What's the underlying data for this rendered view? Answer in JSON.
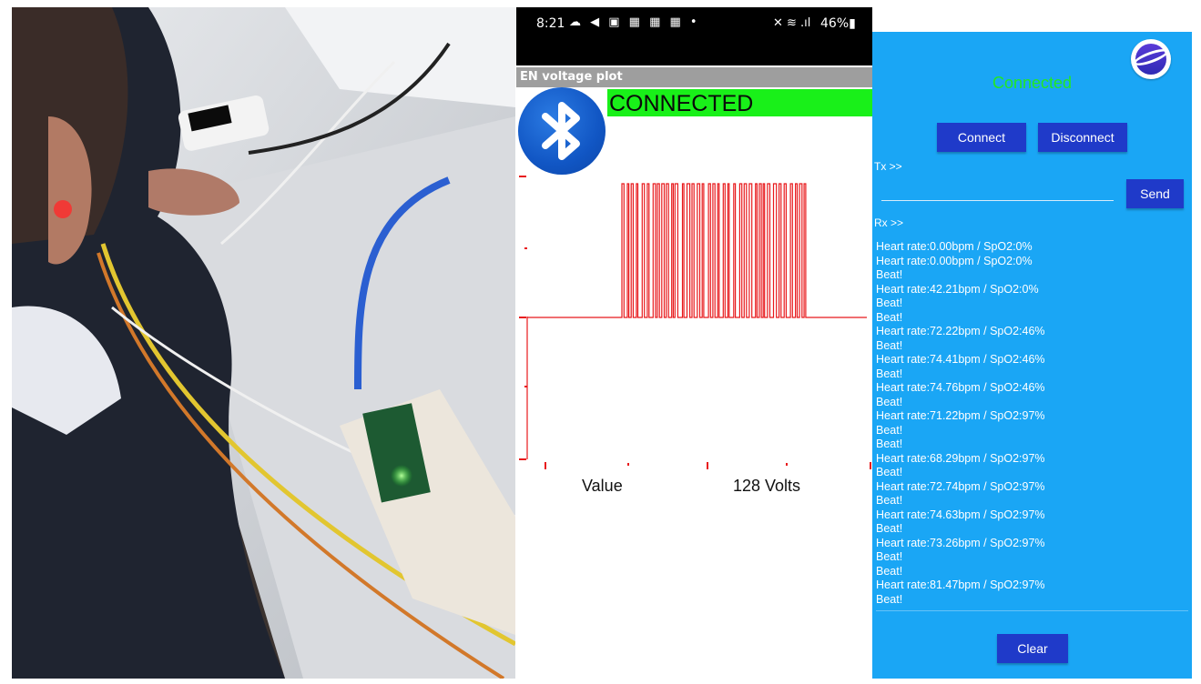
{
  "phone": {
    "status_time": "8:21",
    "status_left_icons": "☁ ◀ ▣ ▦ ▦ ▦ •",
    "status_right_icons": "✕ ≋ .ıl",
    "battery": "46%▮",
    "app_title": "EN voltage plot",
    "banner": "CONNECTED",
    "value_label": "Value",
    "volts_label": "128 Volts",
    "banner_color": "#19f019",
    "plot_color": "#e8191c"
  },
  "monitor": {
    "status": "Connected",
    "connect_label": "Connect",
    "disconnect_label": "Disconnect",
    "tx_label": "Tx >>",
    "tx_value": "",
    "send_label": "Send",
    "rx_label": "Rx >>",
    "clear_label": "Clear",
    "background_color": "#1aa6f5",
    "button_color": "#1f3ac9",
    "log": [
      "Heart rate:0.00bpm / SpO2:0%",
      "Heart rate:0.00bpm / SpO2:0%",
      "Beat!",
      "Heart rate:42.21bpm / SpO2:0%",
      "Beat!",
      "Beat!",
      "Heart rate:72.22bpm / SpO2:46%",
      "Beat!",
      "Heart rate:74.41bpm / SpO2:46%",
      "Beat!",
      "Heart rate:74.76bpm / SpO2:46%",
      "Beat!",
      "Heart rate:71.22bpm / SpO2:97%",
      "Beat!",
      "Beat!",
      "Heart rate:68.29bpm / SpO2:97%",
      "Beat!",
      "Heart rate:72.74bpm / SpO2:97%",
      "Beat!",
      "Heart rate:74.63bpm / SpO2:97%",
      "Beat!",
      "Heart rate:73.26bpm / SpO2:97%",
      "Beat!",
      "Beat!",
      "Heart rate:81.47bpm / SpO2:97%",
      "Beat!"
    ]
  }
}
